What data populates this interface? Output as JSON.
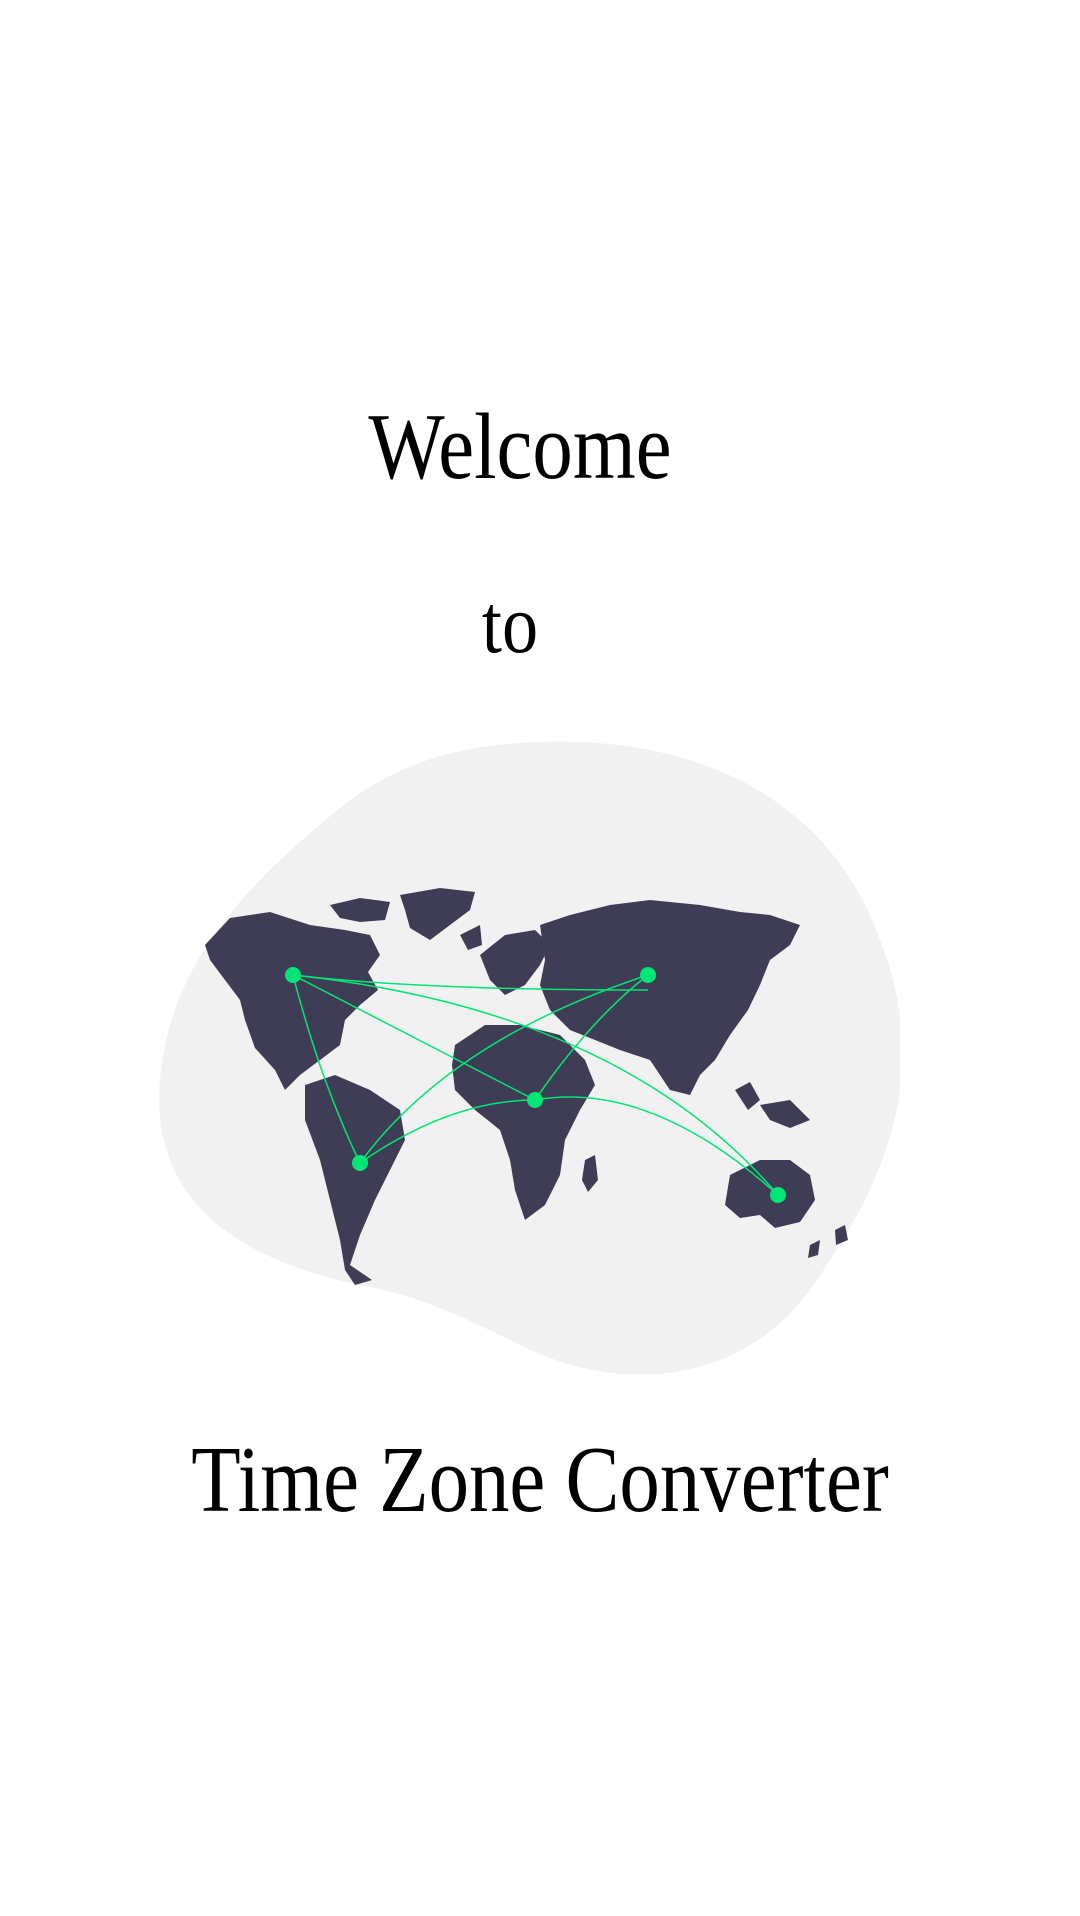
{
  "screen": {
    "greeting": "Welcome",
    "connector": "to",
    "app_name": "Time Zone Converter"
  },
  "illustration": {
    "icon": "world-map-network-icon",
    "colors": {
      "blob": "#f1f1f1",
      "land": "#3f3d56",
      "accent": "#00e676"
    }
  }
}
